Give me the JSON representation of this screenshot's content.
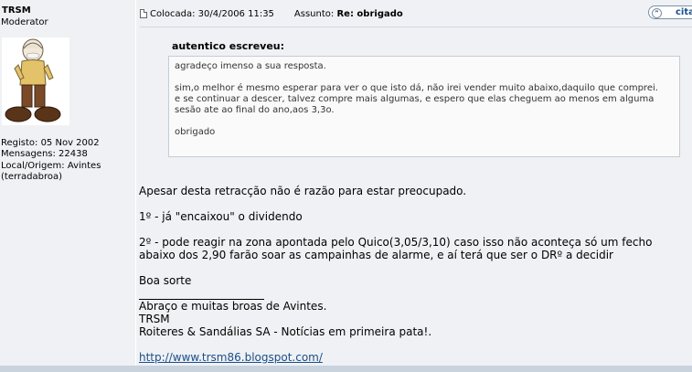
{
  "author": {
    "username": "TRSM",
    "rank": "Moderator",
    "registered": "Registo: 05 Nov 2002",
    "posts": "Mensagens: 22438",
    "location_line1": "Local/Origem: Avintes",
    "location_line2": "(terradabroa)"
  },
  "post": {
    "posted_label": "Colocada: 30/4/2006 11:35",
    "subject_label": "Assunto:",
    "subject": "Re: obrigado",
    "quote_button": "cita"
  },
  "quote": {
    "header": "autentico escreveu:",
    "line1": "agradeço imenso a sua resposta.",
    "line2": "sim,o melhor é mesmo esperar para ver o que isto dá, não irei vender muito abaixo,daquilo que comprei.",
    "line3": "e se continuar a descer, talvez compre mais algumas, e espero que elas cheguem ao menos em alguma sesão ate ao final do ano,aos 3,3o.",
    "line4": "obrigado"
  },
  "body": {
    "p1": "Apesar desta retracção não é razão para estar preocupado.",
    "p2": "1º - já \"encaixou\" o dividendo",
    "p3": "2º - pode reagir na zona apontada pelo Quico(3,05/3,10) caso isso não aconteça só um fecho abaixo dos 2,90 farão soar as campainhas de alarme, e aí terá que ser o DRº a decidir",
    "p4": "Boa sorte"
  },
  "signature": {
    "line1": "Abraço e muitas broas de Avintes.",
    "line2": "TRSM",
    "line3": "Roiteres & Sandálias SA - Notícias em primeira pata!.",
    "link": "http://www.trsm86.blogspot.com/"
  },
  "icons": {
    "post": "post-icon",
    "quote": "quote-icon",
    "avatar": "avatar-old-man-image"
  },
  "colors": {
    "panel": "#eff1f4",
    "link": "#1a4f8a"
  }
}
